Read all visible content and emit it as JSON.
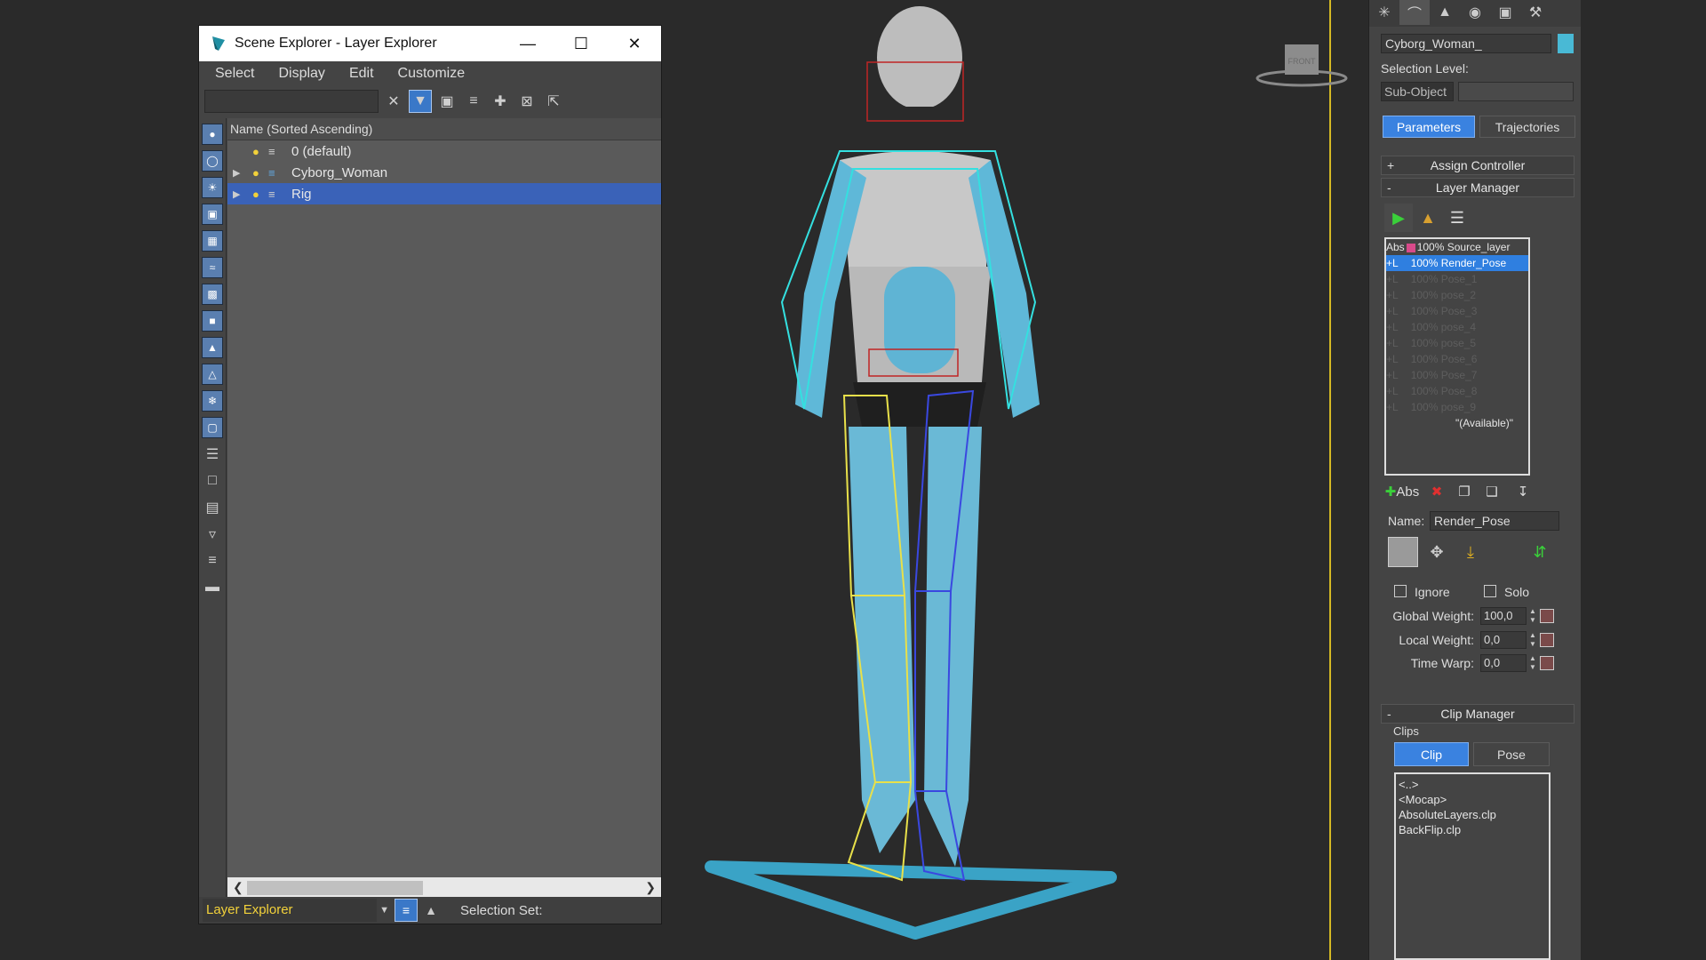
{
  "scene_explorer": {
    "title": "Scene Explorer - Layer Explorer",
    "menu": [
      "Select",
      "Display",
      "Edit",
      "Customize"
    ],
    "column_header": "Name (Sorted Ascending)",
    "rows": [
      {
        "label": "0 (default)",
        "expandable": false,
        "selected": false
      },
      {
        "label": "Cyborg_Woman",
        "expandable": true,
        "selected": false
      },
      {
        "label": "Rig",
        "expandable": true,
        "selected": true
      }
    ],
    "status": {
      "explorer": "Layer Explorer",
      "selection_set": "Selection Set:"
    }
  },
  "viewport": {
    "view_cube": "FRONT"
  },
  "command_panel": {
    "object_name": "Cyborg_Woman_",
    "object_color": "#49b9d5",
    "selection_level_label": "Selection Level:",
    "sub_object": "Sub-Object",
    "tabs": {
      "parameters": "Parameters",
      "trajectories": "Trajectories"
    },
    "assign_controller": "Assign Controller",
    "layer_manager": {
      "title": "Layer Manager",
      "layers": [
        {
          "mode": "Abs",
          "weight": "100%",
          "name": "Source_layer",
          "active": false,
          "enabled": true
        },
        {
          "mode": "+L",
          "weight": "100%",
          "name": "Render_Pose",
          "active": true,
          "enabled": true
        },
        {
          "mode": "+L",
          "weight": "100%",
          "name": "Pose_1",
          "active": false,
          "enabled": false
        },
        {
          "mode": "+L",
          "weight": "100%",
          "name": "pose_2",
          "active": false,
          "enabled": false
        },
        {
          "mode": "+L",
          "weight": "100%",
          "name": "Pose_3",
          "active": false,
          "enabled": false
        },
        {
          "mode": "+L",
          "weight": "100%",
          "name": "pose_4",
          "active": false,
          "enabled": false
        },
        {
          "mode": "+L",
          "weight": "100%",
          "name": "pose_5",
          "active": false,
          "enabled": false
        },
        {
          "mode": "+L",
          "weight": "100%",
          "name": "Pose_6",
          "active": false,
          "enabled": false
        },
        {
          "mode": "+L",
          "weight": "100%",
          "name": "Pose_7",
          "active": false,
          "enabled": false
        },
        {
          "mode": "+L",
          "weight": "100%",
          "name": "Pose_8",
          "active": false,
          "enabled": false
        },
        {
          "mode": "+L",
          "weight": "100%",
          "name": "pose_9",
          "active": false,
          "enabled": false
        }
      ],
      "available": "\"(Available)\"",
      "abs_button": "Abs",
      "name_label": "Name:",
      "name_value": "Render_Pose",
      "ignore_label": "Ignore",
      "solo_label": "Solo",
      "global_weight_label": "Global Weight:",
      "global_weight": "100,0",
      "local_weight_label": "Local Weight:",
      "local_weight": "0,0",
      "time_warp_label": "Time Warp:",
      "time_warp": "0,0"
    },
    "clip_manager": {
      "title": "Clip Manager",
      "clips_label": "Clips",
      "tabs": {
        "clip": "Clip",
        "pose": "Pose"
      },
      "items": [
        "<..>",
        "<Mocap>",
        "AbsoluteLayers.clp",
        "BackFlip.clp"
      ]
    }
  }
}
